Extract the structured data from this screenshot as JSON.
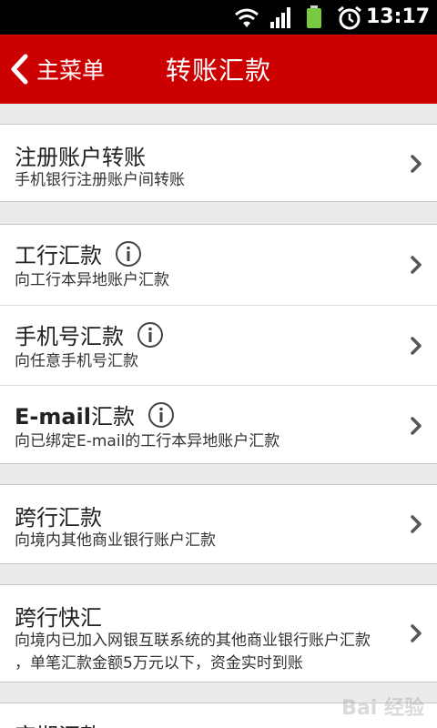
{
  "status_bar": {
    "time": "13:17",
    "icons": [
      "wifi-icon",
      "signal-icon",
      "battery-icon",
      "alarm-icon"
    ]
  },
  "header": {
    "back_label": "主菜单",
    "title": "转账汇款",
    "background_color": "#cc0000"
  },
  "sections": [
    {
      "items": [
        {
          "title": "注册账户转账",
          "desc": "手机银行注册账户间转账",
          "info": false
        }
      ]
    },
    {
      "items": [
        {
          "title": "工行汇款",
          "desc": "向工行本异地账户汇款",
          "info": true
        },
        {
          "title": "手机号汇款",
          "desc": "向任意手机号汇款",
          "info": true
        },
        {
          "title_prefix": "E-mail",
          "title_suffix": "汇款",
          "desc": "向已绑定E-mail的工行本异地账户汇款",
          "info": true
        }
      ]
    },
    {
      "items": [
        {
          "title": "跨行汇款",
          "desc": "向境内其他商业银行账户汇款",
          "info": false
        }
      ]
    },
    {
      "items": [
        {
          "title": "跨行快汇",
          "desc_line1": "向境内已加入网银互联系统的其他商业银行账户汇款",
          "desc_line2": "，单笔汇款金额5万元以下，资金实时到账",
          "info": false
        }
      ]
    },
    {
      "items": [
        {
          "title": "定期汇款"
        }
      ]
    }
  ],
  "watermark": "Bai 经验"
}
